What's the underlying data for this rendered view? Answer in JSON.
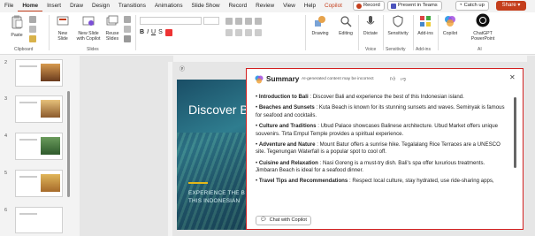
{
  "menu": {
    "items": [
      "File",
      "Home",
      "Insert",
      "Draw",
      "Design",
      "Transitions",
      "Animations",
      "Slide Show",
      "Record",
      "Review",
      "View",
      "Help",
      "Copilot"
    ],
    "record_label": "Record",
    "teams_label": "Present in Teams",
    "catchup_label": "Catch up",
    "share_label": "Share"
  },
  "ribbon": {
    "paste": "Paste",
    "new_slide": "New\nSlide",
    "new_slide_copilot": "New Slide\nwith Copilot",
    "reuse_slides": "Reuse\nSlides",
    "drawing": "Drawing",
    "editing": "Editing",
    "dictate": "Dictate",
    "sensitivity": "Sensitivity",
    "addins": "Add-ins",
    "copilot": "Copilot",
    "chatgpt": "ChatGPT\nPowerPoint",
    "groups": {
      "clipboard": "Clipboard",
      "slides": "Slides",
      "voice": "Voice",
      "sensitivity": "Sensitivity",
      "addins": "Add-ins",
      "ai": "AI"
    }
  },
  "thumbnails": {
    "numbers": [
      "2",
      "3",
      "4",
      "5",
      "6"
    ]
  },
  "slide": {
    "title": "Discover B",
    "subtitle_line1": "EXPERIENCE THE B",
    "subtitle_line2": "THIS INDONESIAN"
  },
  "summary": {
    "title": "Summary",
    "note": "AI-generated content may be incorrect",
    "items": [
      {
        "head": "Introduction to Bali",
        "text": " : Discover Bali and experience the best of this Indonesian island."
      },
      {
        "head": "Beaches and Sunsets",
        "text": " : Kuta Beach is known for its stunning sunsets and waves. Seminyak is famous for seafood and cocktails."
      },
      {
        "head": "Culture and Traditions",
        "text": " : Ubud Palace showcases Balinese architecture. Ubud Market offers unique souvenirs. Tirta Empul Temple provides a spiritual experience."
      },
      {
        "head": "Adventure and Nature",
        "text": " : Mount Batur offers a sunrise hike. Tegalalang Rice Terraces are a UNESCO site. Tegenungan Waterfall is a popular spot to cool off."
      },
      {
        "head": "Cuisine and Relaxation",
        "text": " : Nasi Goreng is a must-try dish. Bali's spa offer luxurious treatments. Jimbaran Beach is ideal for a seafood dinner."
      },
      {
        "head": "Travel Tips and Recommendations",
        "text": " : Respect local culture, stay hydrated, use ride-sharing apps,"
      }
    ],
    "chat_button": "Chat with Copilot"
  },
  "colors": {
    "accent": "#c43e1c",
    "panel_border": "#d21f1f"
  }
}
